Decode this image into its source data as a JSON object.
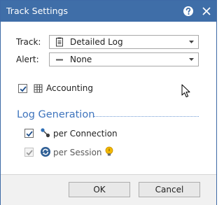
{
  "window": {
    "title": "Track Settings",
    "help_icon": "help-icon",
    "close_icon": "close-icon"
  },
  "track": {
    "label": "Track:",
    "value": "Detailed Log",
    "icon": "document-icon"
  },
  "alert": {
    "label": "Alert:",
    "value": "None",
    "icon": "dash-icon"
  },
  "accounting": {
    "checked": true,
    "icon": "grid-icon",
    "label": "Accounting"
  },
  "log_generation": {
    "title": "Log Generation",
    "per_connection": {
      "checked": true,
      "icon": "connection-nodes-icon",
      "label": "per Connection"
    },
    "per_session": {
      "checked": true,
      "disabled": true,
      "icon": "session-icon",
      "label": "per Session",
      "hint_icon": "lightbulb-icon"
    }
  },
  "buttons": {
    "ok": "OK",
    "cancel": "Cancel"
  },
  "colors": {
    "titlebar": "#3f6ea8",
    "section_title": "#3e74bd",
    "check": "#1e4f8c"
  }
}
